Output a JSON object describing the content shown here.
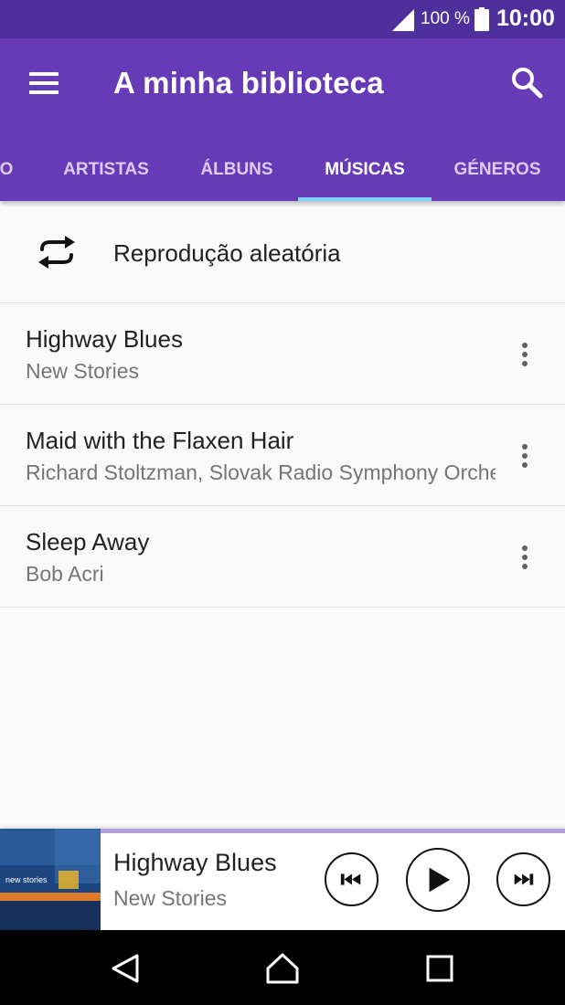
{
  "status_bar": {
    "battery_percent": "100 %",
    "time": "10:00"
  },
  "app_bar": {
    "title": "A minha biblioteca",
    "menu_icon": "hamburger-menu-icon",
    "search_icon": "search-icon"
  },
  "tabs": [
    {
      "label": "O",
      "active": false
    },
    {
      "label": "ARTISTAS",
      "active": false
    },
    {
      "label": "ÁLBUNS",
      "active": false
    },
    {
      "label": "MÚSICAS",
      "active": true
    },
    {
      "label": "GÉNEROS",
      "active": false
    }
  ],
  "shuffle": {
    "label": "Reprodução aleatória",
    "icon": "shuffle-repeat-icon"
  },
  "songs": [
    {
      "title": "Highway Blues",
      "artist": "New Stories"
    },
    {
      "title": "Maid with the Flaxen Hair",
      "artist": "Richard Stoltzman, Slovak Radio Symphony Orchestra"
    },
    {
      "title": "Sleep Away",
      "artist": "Bob Acri"
    }
  ],
  "now_playing": {
    "title": "Highway Blues",
    "artist": "New Stories",
    "progress": 0.0,
    "album_art_text": "new stories"
  },
  "colors": {
    "status_bar": "#4f2f9c",
    "app_bar": "#673ab7",
    "tab_indicator": "#7fd3f7",
    "background": "#fafafa"
  }
}
